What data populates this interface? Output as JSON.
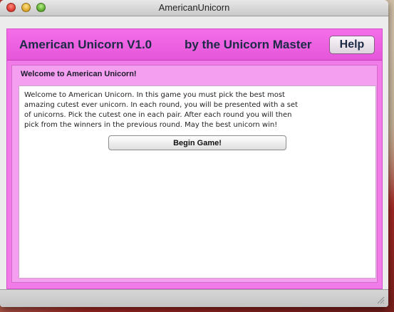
{
  "window": {
    "title": "AmericanUnicorn"
  },
  "header": {
    "app_name": "American Unicorn V1.0",
    "author": "by the Unicorn Master",
    "help_label": "Help"
  },
  "panel": {
    "title": "Welcome to American Unicorn!",
    "intro": "Welcome to American Unicorn. In this game you must pick the best most\namazing cutest ever unicorn. In each round, you will be presented with a set\nof unicorns. Pick the cutest one in each pair. After each round you will then\npick from the winners in the previous round. May the best unicorn win!",
    "begin_label": "Begin Game!"
  },
  "colors": {
    "app_background": "#f27bea",
    "header_background": "#e656da",
    "panel_background": "#f59ff0",
    "header_text": "#1c2a46"
  }
}
